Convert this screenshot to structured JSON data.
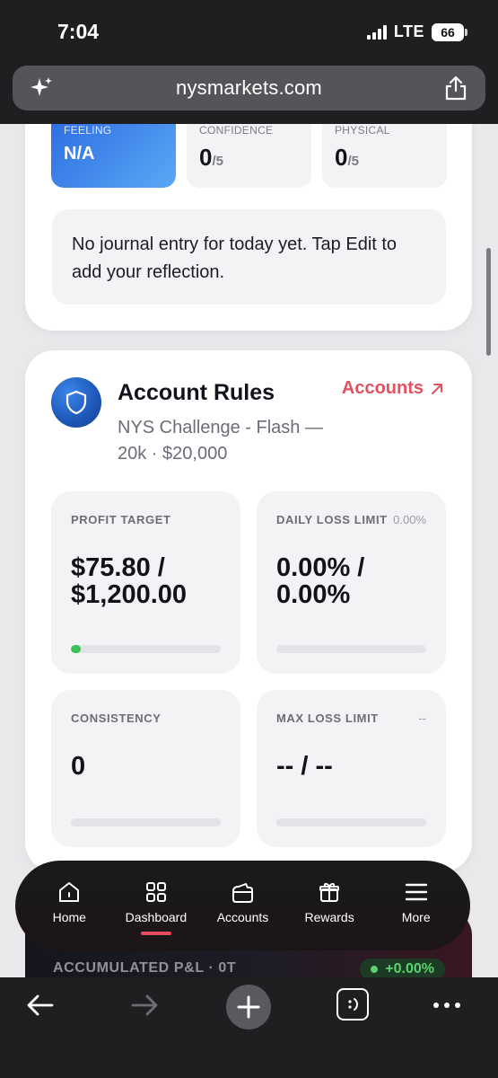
{
  "status_bar": {
    "time": "7:04",
    "network": "LTE",
    "battery": "66"
  },
  "browser": {
    "url": "nysmarkets.com"
  },
  "journal": {
    "metrics": [
      {
        "label": "FEELING",
        "value": "N/A",
        "suffix": ""
      },
      {
        "label": "CONFIDENCE",
        "value": "0",
        "suffix": "/5"
      },
      {
        "label": "PHYSICAL",
        "value": "0",
        "suffix": "/5"
      }
    ],
    "note": "No journal entry for today yet. Tap Edit to add your reflection."
  },
  "account_rules": {
    "title": "Account Rules",
    "subtitle": "NYS Challenge - Flash — 20k · $20,000",
    "link_label": "Accounts",
    "rules": {
      "profit_target": {
        "label": "PROFIT TARGET",
        "side": "",
        "value": "$75.80 / $1,200.00",
        "progress": 0.063
      },
      "daily_loss": {
        "label": "DAILY LOSS LIMIT",
        "side": "0.00%",
        "value": "0.00% / 0.00%",
        "progress": 0
      },
      "consistency": {
        "label": "CONSISTENCY",
        "side": "",
        "value": "0",
        "progress": 0
      },
      "max_loss": {
        "label": "MAX LOSS LIMIT",
        "side": "--",
        "value": "-- / --",
        "progress": 0
      }
    }
  },
  "pnl": {
    "label": "ACCUMULATED P&L · 0T",
    "change": "+0.00%"
  },
  "app_nav": {
    "items": [
      {
        "label": "Home",
        "icon": "home-icon"
      },
      {
        "label": "Dashboard",
        "icon": "grid-icon",
        "active": true
      },
      {
        "label": "Accounts",
        "icon": "wallet-icon"
      },
      {
        "label": "Rewards",
        "icon": "gift-icon"
      },
      {
        "label": "More",
        "icon": "menu-icon"
      }
    ]
  },
  "colors": {
    "accent": "#e0525f",
    "success": "#3cc159",
    "feeling_blue": "#2f6fe3"
  }
}
